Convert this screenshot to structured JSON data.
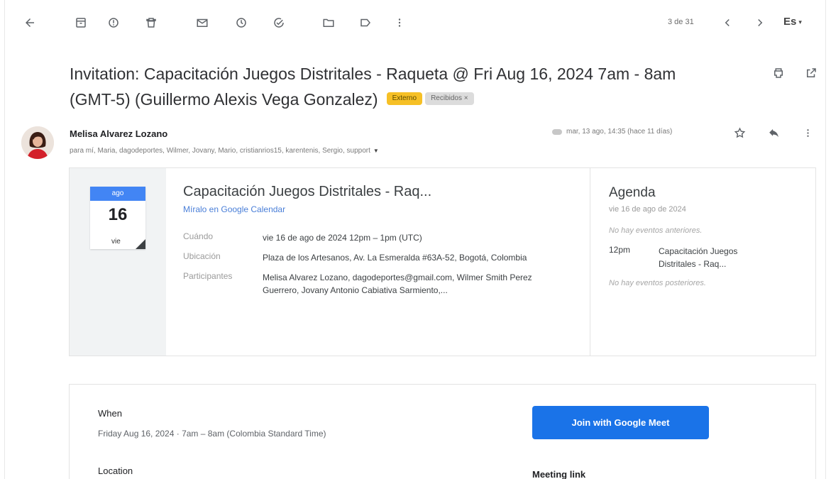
{
  "toolbar": {
    "pager": "3 de 31",
    "language": "Es"
  },
  "subject": {
    "line1": "Invitation: Capacitación Juegos Distritales - Raqueta @ Fri Aug 16, 2024 7am - 8am",
    "line2": "(GMT-5) (Guillermo Alexis Vega Gonzalez)",
    "chip_external": "Externo",
    "chip_inbox": "Recibidos ×"
  },
  "sender": {
    "name": "Melisa Alvarez Lozano",
    "recipients": "para mí, Maria, dagodeportes, Wilmer, Jovany, Mario, cristianrios15, karentenis, Sergio, support",
    "date": "mar, 13 ago, 14:35 (hace 11 días)"
  },
  "invite": {
    "cal_month": "ago",
    "cal_day": "16",
    "cal_dow": "vie",
    "title": "Capacitación Juegos Distritales - Raq...",
    "calendar_link": "Míralo en Google Calendar",
    "when_label": "Cuándo",
    "when_value": "vie 16 de ago de 2024 12pm – 1pm (UTC)",
    "location_label": "Ubicación",
    "location_value": "Plaza de los Artesanos, Av. La Esmeralda #63A-52, Bogotá, Colombia",
    "guests_label": "Participantes",
    "guests_value": "Melisa Alvarez Lozano, dagodeportes@gmail.com, Wilmer Smith Perez Guerrero, Jovany Antonio Cabiativa Sarmiento,..."
  },
  "agenda": {
    "title": "Agenda",
    "date": "vie 16 de ago de 2024",
    "no_before": "No hay eventos anteriores.",
    "event_time": "12pm",
    "event_name": "Capacitación Juegos Distritales - Raq...",
    "no_after": "No hay eventos posteriores."
  },
  "details": {
    "when_label": "When",
    "when_value": "Friday Aug 16, 2024 · 7am – 8am (Colombia Standard Time)",
    "location_label": "Location",
    "meet_button": "Join with Google Meet",
    "meeting_link_label": "Meeting link"
  },
  "colors": {
    "accent": "#1a73e8",
    "chip_external": "#f6c026",
    "calendar_month": "#4285f4"
  }
}
